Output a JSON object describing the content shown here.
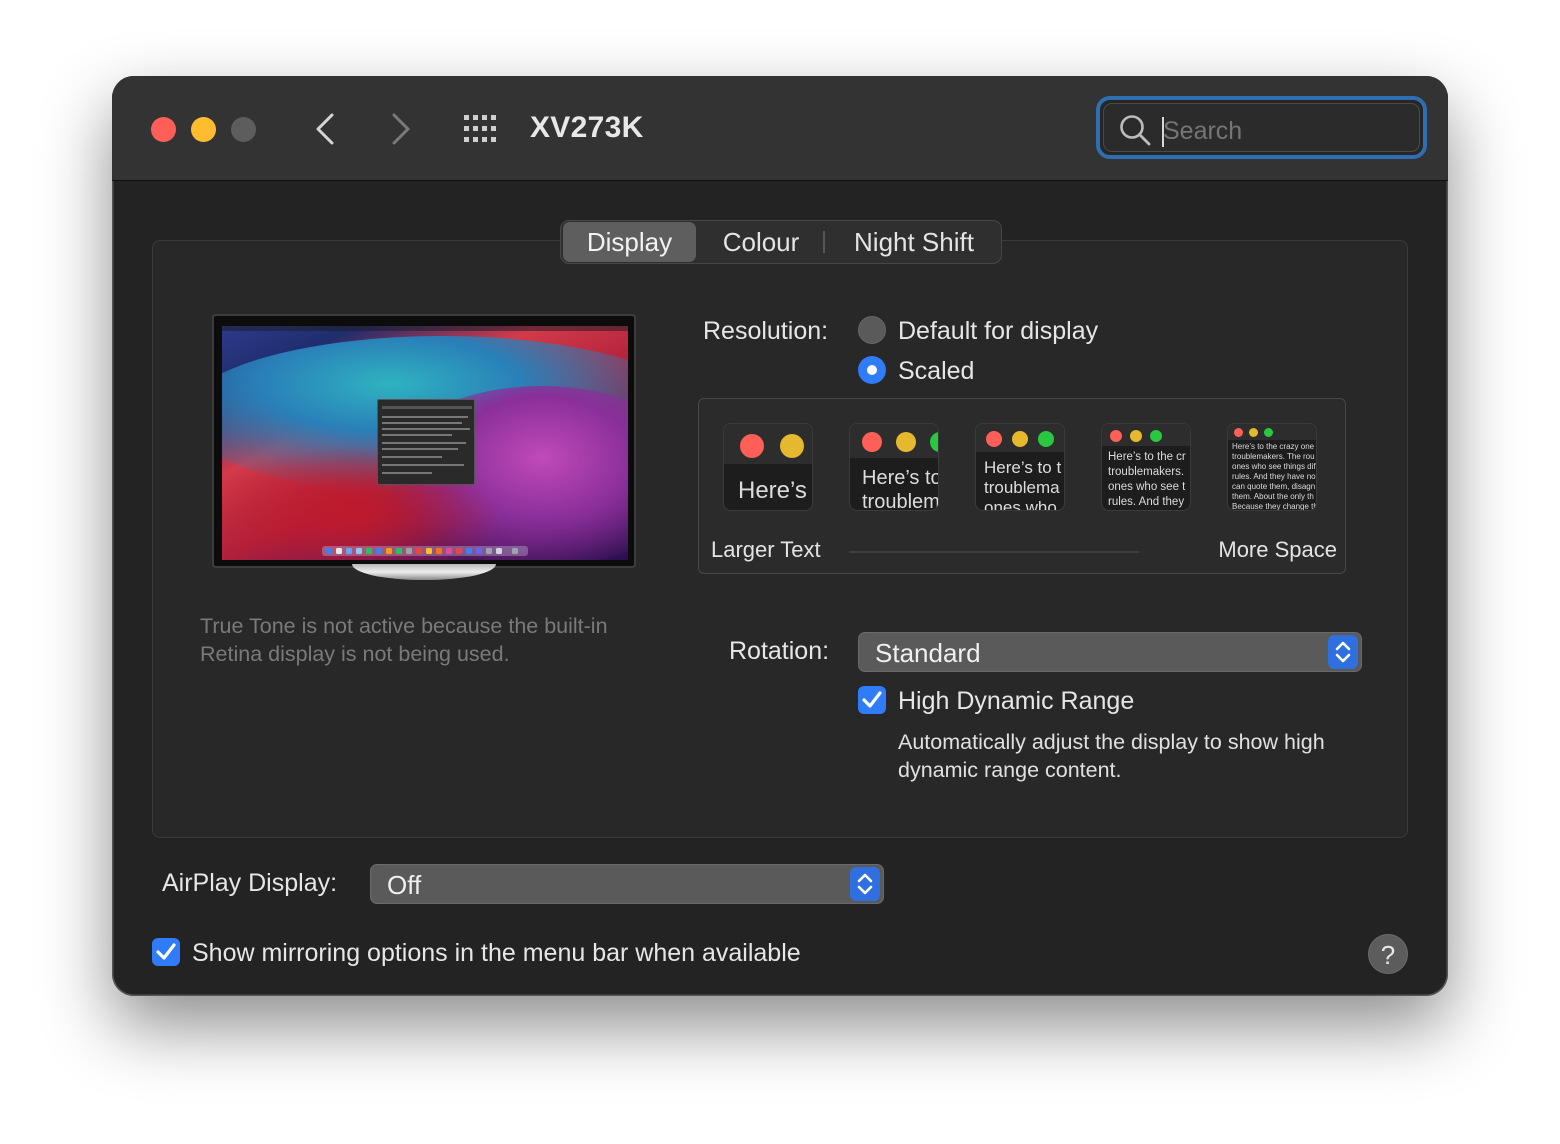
{
  "window": {
    "title": "XV273K",
    "search": {
      "placeholder": "Search"
    }
  },
  "tabs": [
    {
      "label": "Display",
      "selected": true
    },
    {
      "label": "Colour",
      "selected": false
    },
    {
      "label": "Night Shift",
      "selected": false
    }
  ],
  "true_tone_note": "True Tone is not active because the built-in Retina display is not being used.",
  "resolution": {
    "label": "Resolution:",
    "options": [
      {
        "label": "Default for display",
        "selected": false
      },
      {
        "label": "Scaled",
        "selected": true
      }
    ],
    "scale_min_label": "Larger Text",
    "scale_max_label": "More Space",
    "thumbnails": [
      {
        "text": "Here’s"
      },
      {
        "text": "Here’s to\ntroublem"
      },
      {
        "text": "Here’s to t\ntroublema\nones who"
      },
      {
        "text": "Here’s to the cr\ntroublemakers.\nones who see t\nrules. And they"
      },
      {
        "text": "Here’s to the crazy one\ntroublemakers. The rou\nones who see things dif\nrules. And they have no\ncan quote them, disagn\nthem. About the only th\nBecause they change th"
      }
    ],
    "selected_index": 0
  },
  "rotation": {
    "label": "Rotation:",
    "value": "Standard"
  },
  "hdr": {
    "label": "High Dynamic Range",
    "checked": true,
    "description": "Automatically adjust the display to show high dynamic range content."
  },
  "airplay": {
    "label": "AirPlay Display:",
    "value": "Off"
  },
  "mirroring": {
    "label": "Show mirroring options in the menu bar when available",
    "checked": true
  },
  "help_label": "?",
  "colors": {
    "accent": "#2f7cf6",
    "focus_ring": "#2f6fb1",
    "window_bg": "#232323"
  }
}
